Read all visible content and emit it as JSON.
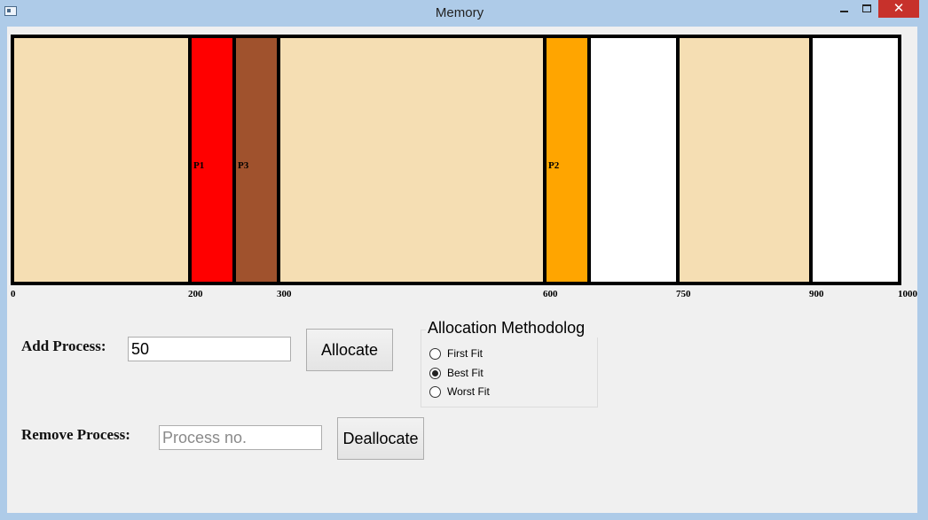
{
  "window": {
    "title": "Memory",
    "controls": {
      "minimize": "",
      "maximize": "",
      "close": "✕"
    }
  },
  "memory_map": {
    "total": 1000,
    "segments": [
      {
        "start": 0,
        "end": 200,
        "label": "",
        "color": "#f5deb3"
      },
      {
        "start": 200,
        "end": 250,
        "label": "P1",
        "color": "#ff0000"
      },
      {
        "start": 250,
        "end": 300,
        "label": "P3",
        "color": "#a0522d"
      },
      {
        "start": 300,
        "end": 600,
        "label": "",
        "color": "#f5deb3"
      },
      {
        "start": 600,
        "end": 650,
        "label": "P2",
        "color": "#ffa500"
      },
      {
        "start": 650,
        "end": 750,
        "label": "",
        "color": "#ffffff"
      },
      {
        "start": 750,
        "end": 900,
        "label": "",
        "color": "#f5deb3"
      },
      {
        "start": 900,
        "end": 1000,
        "label": "",
        "color": "#ffffff"
      }
    ],
    "ticks": [
      "0",
      "200",
      "300",
      "600",
      "750",
      "900",
      "1000"
    ]
  },
  "add_process": {
    "label": "Add Process:",
    "value": "50",
    "button": "Allocate"
  },
  "remove_process": {
    "label": "Remove Process:",
    "placeholder": "Process no.",
    "value": "",
    "button": "Deallocate"
  },
  "allocation": {
    "title": "Allocation Methodolog",
    "options": [
      {
        "label": "First Fit",
        "selected": false
      },
      {
        "label": "Best Fit",
        "selected": true
      },
      {
        "label": "Worst Fit",
        "selected": false
      }
    ]
  }
}
